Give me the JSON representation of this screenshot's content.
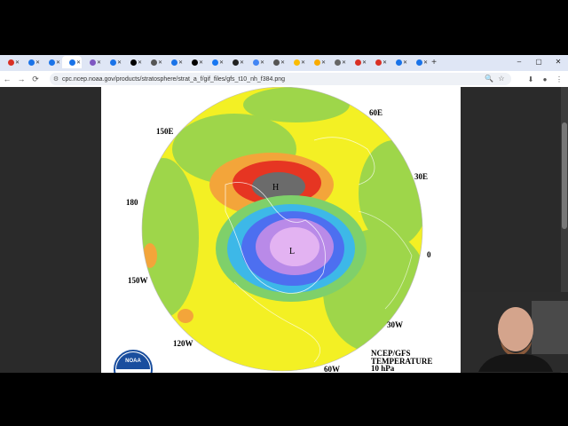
{
  "browser": {
    "tabs": [
      {
        "color": "#d93025"
      },
      {
        "color": "#1a73e8"
      },
      {
        "color": "#1a73e8"
      },
      {
        "color": "#1a73e8"
      },
      {
        "color": "#7e57c2"
      },
      {
        "color": "#1a73e8"
      },
      {
        "color": "#000000"
      },
      {
        "color": "#555555"
      },
      {
        "color": "#1a73e8"
      },
      {
        "color": "#000000"
      },
      {
        "color": "#1877f2"
      },
      {
        "color": "#222222"
      },
      {
        "color": "#4285f4"
      },
      {
        "color": "#555555"
      },
      {
        "color": "#fbbc04"
      },
      {
        "color": "#f9ab00"
      },
      {
        "color": "#666666"
      },
      {
        "color": "#d93025"
      },
      {
        "color": "#d93025"
      },
      {
        "color": "#1a73e8"
      },
      {
        "color": "#1a73e8"
      }
    ],
    "active_tab_index": 3,
    "url": "cpc.ncep.noaa.gov/products/stratosphere/strat_a_f/gif_files/gfs_t10_nh_f384.png",
    "new_tab": "+",
    "window_controls": {
      "minimize": "–",
      "maximize": "▢",
      "close": "✕"
    }
  },
  "map": {
    "longitude_labels": {
      "lon_60e": "60E",
      "lon_150e": "150E",
      "lon_30e": "30E",
      "lon_180": "180",
      "lon_0": "0",
      "lon_150w": "150W",
      "lon_30w": "30W",
      "lon_120w": "120W",
      "lon_60w": "60W"
    },
    "high_label": "H",
    "low_label": "L",
    "title_line1": "NCEP/GFS",
    "title_line2": "TEMPERATURE",
    "title_line3": "10 hPa",
    "logo_text": "NOAA"
  },
  "colors": {
    "background_field": "#f3f024",
    "green": "#9ed64a",
    "orange": "#f3a53a",
    "red": "#e63522",
    "dark_gray": "#6b6b6b",
    "cyan": "#3db8e8",
    "blue": "#4d6ff0",
    "purple": "#b98ae8",
    "violet": "#e3b3f2"
  }
}
